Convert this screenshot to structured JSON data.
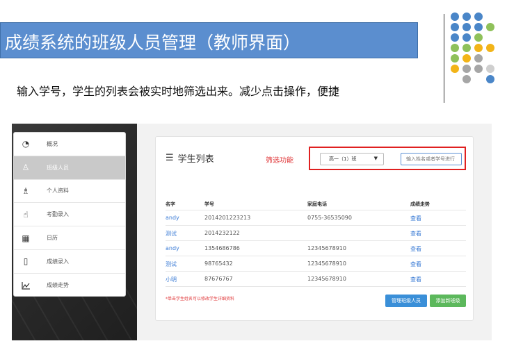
{
  "slide": {
    "title": "成绩系统的班级人员管理（教师界面）",
    "description": "输入学号，学生的列表会被实时地筛选出来。减少点击操作，便捷"
  },
  "decor_dot_colors": [
    "#4a86c8",
    "#8fc15a",
    "#f2b418",
    "#a6a6a6"
  ],
  "sidebar": {
    "items": [
      {
        "label": "概况",
        "icon": "dashboard-icon"
      },
      {
        "label": "班级人员",
        "icon": "user-icon",
        "active": true
      },
      {
        "label": "个人资料",
        "icon": "users-icon"
      },
      {
        "label": "考勤录入",
        "icon": "hand-pointer-icon"
      },
      {
        "label": "日历",
        "icon": "calendar-icon"
      },
      {
        "label": "成绩录入",
        "icon": "file-icon"
      },
      {
        "label": "成绩走势",
        "icon": "line-chart-icon"
      }
    ]
  },
  "panel": {
    "title": "学生列表",
    "filter_label": "筛选功能",
    "class_select": "高一（1）班",
    "search_placeholder": "输入姓名或者学号进行",
    "columns": [
      "名字",
      "学号",
      "家庭电话",
      "成绩走势"
    ],
    "rows": [
      {
        "name": "andy",
        "id": "2014201223213",
        "phone": "0755-36535090",
        "trend": "查看"
      },
      {
        "name": "测试",
        "id": "2014232122",
        "phone": "",
        "trend": "查看"
      },
      {
        "name": "andy",
        "id": "1354686786",
        "phone": "12345678910",
        "trend": "查看"
      },
      {
        "name": "测试",
        "id": "98765432",
        "phone": "12345678910",
        "trend": "查看"
      },
      {
        "name": "小明",
        "id": "87676767",
        "phone": "12345678910",
        "trend": "查看"
      }
    ],
    "note": "*单击学生姓名可以修改学生详细资料",
    "manage_button": "管理班级人员",
    "add_button": "添加新班级"
  }
}
